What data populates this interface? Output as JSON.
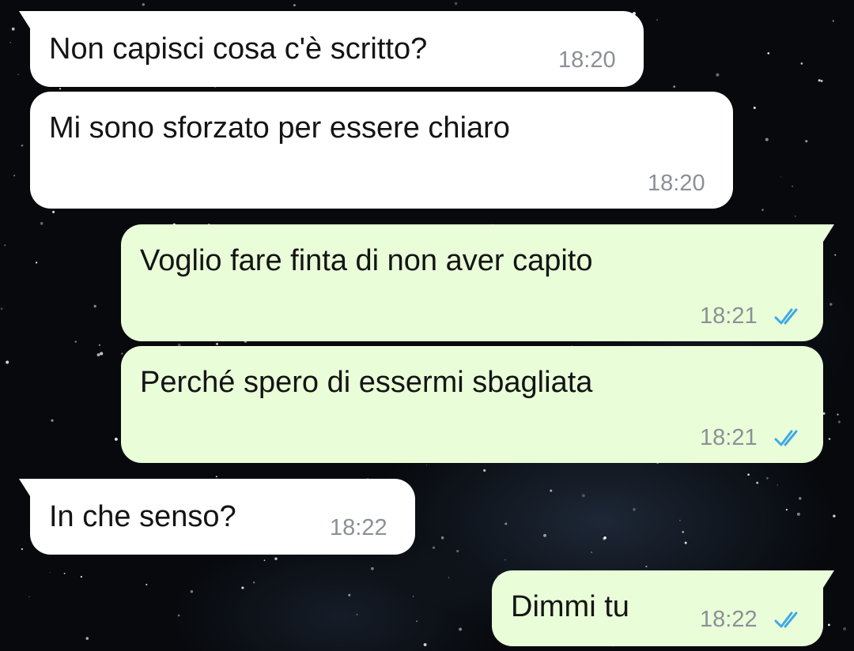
{
  "colors": {
    "incoming_bubble": "#ffffff",
    "outgoing_bubble": "#e9fed8",
    "read_ticks": "#3fa8e8",
    "timestamp": "#8b9097"
  },
  "messages": [
    {
      "direction": "incoming",
      "text": "Non capisci cosa c'è scritto?",
      "time": "18:20"
    },
    {
      "direction": "incoming",
      "text": "Mi sono sforzato per essere chiaro",
      "time": "18:20"
    },
    {
      "direction": "outgoing",
      "text": "Voglio fare finta di non aver capito",
      "time": "18:21",
      "status_icon": "double-check-read-icon"
    },
    {
      "direction": "outgoing",
      "text": "Perché spero di essermi sbagliata",
      "time": "18:21",
      "status_icon": "double-check-read-icon"
    },
    {
      "direction": "incoming",
      "text": "In che senso?",
      "time": "18:22"
    },
    {
      "direction": "outgoing",
      "text": "Dimmi tu",
      "time": "18:22",
      "status_icon": "double-check-read-icon"
    }
  ]
}
